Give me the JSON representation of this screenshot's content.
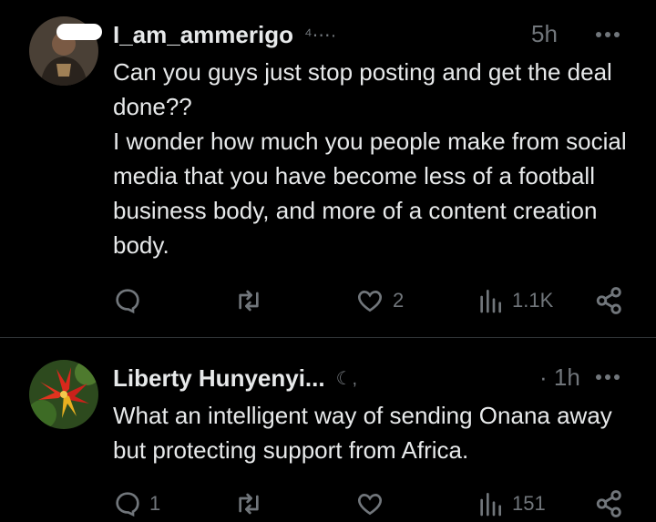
{
  "posts": [
    {
      "username": "I_am_ammerigo",
      "handle": "⁴⋯·",
      "time": "5h",
      "text_lines": [
        "Can you guys just stop posting and get the deal done??",
        "I wonder how much you people make from social media that you have become less of a football business body, and more of a content creation body."
      ],
      "actions": {
        "reply": "",
        "repost": "",
        "like": "2",
        "views": "1.1K"
      }
    },
    {
      "username": "Liberty Hunyenyi...",
      "handle": "☾,",
      "time": "· 1h",
      "text_lines": [
        "What an intelligent way of sending Onana away but protecting support from Africa."
      ],
      "actions": {
        "reply": "1",
        "repost": "",
        "like": "",
        "views": "151"
      }
    }
  ],
  "colors": {
    "background": "#000000",
    "text": "#e7e9ea",
    "muted": "#71767b",
    "divider": "#2f3336"
  },
  "icons": [
    "more-icon",
    "reply-icon",
    "repost-icon",
    "like-icon",
    "views-icon",
    "share-icon"
  ]
}
